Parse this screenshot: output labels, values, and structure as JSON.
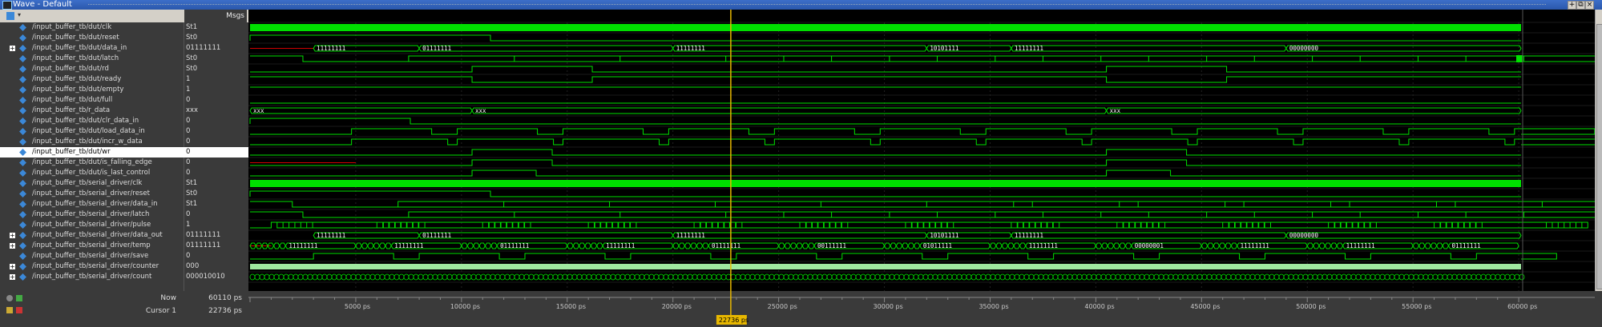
{
  "window": {
    "title": "Wave - Default"
  },
  "header": {
    "msgs_label": "Msgs"
  },
  "signals": [
    {
      "name": "/input_buffer_tb/dut/clk",
      "value": "St1",
      "expand": false
    },
    {
      "name": "/input_buffer_tb/dut/reset",
      "value": "St0",
      "expand": false
    },
    {
      "name": "/input_buffer_tb/dut/data_in",
      "value": "01111111",
      "expand": true
    },
    {
      "name": "/input_buffer_tb/dut/latch",
      "value": "St0",
      "expand": false
    },
    {
      "name": "/input_buffer_tb/dut/rd",
      "value": "St0",
      "expand": false
    },
    {
      "name": "/input_buffer_tb/dut/ready",
      "value": "1",
      "expand": false
    },
    {
      "name": "/input_buffer_tb/dut/empty",
      "value": "1",
      "expand": false
    },
    {
      "name": "/input_buffer_tb/dut/full",
      "value": "0",
      "expand": false
    },
    {
      "name": "/input_buffer_tb/r_data",
      "value": "xxx",
      "expand": false
    },
    {
      "name": "/input_buffer_tb/dut/clr_data_in",
      "value": "0",
      "expand": false
    },
    {
      "name": "/input_buffer_tb/dut/load_data_in",
      "value": "0",
      "expand": false
    },
    {
      "name": "/input_buffer_tb/dut/incr_w_data",
      "value": "0",
      "expand": false
    },
    {
      "name": "/input_buffer_tb/dut/wr",
      "value": "0",
      "expand": false,
      "selected": true
    },
    {
      "name": "/input_buffer_tb/dut/is_falling_edge",
      "value": "0",
      "expand": false
    },
    {
      "name": "/input_buffer_tb/dut/is_last_control",
      "value": "0",
      "expand": false
    },
    {
      "name": "/input_buffer_tb/serial_driver/clk",
      "value": "St1",
      "expand": false
    },
    {
      "name": "/input_buffer_tb/serial_driver/reset",
      "value": "St0",
      "expand": false
    },
    {
      "name": "/input_buffer_tb/serial_driver/data_in",
      "value": "St1",
      "expand": false
    },
    {
      "name": "/input_buffer_tb/serial_driver/latch",
      "value": "0",
      "expand": false
    },
    {
      "name": "/input_buffer_tb/serial_driver/pulse",
      "value": "1",
      "expand": false
    },
    {
      "name": "/input_buffer_tb/serial_driver/data_out",
      "value": "01111111",
      "expand": true
    },
    {
      "name": "/input_buffer_tb/serial_driver/temp",
      "value": "01111111",
      "expand": true
    },
    {
      "name": "/input_buffer_tb/serial_driver/save",
      "value": "0",
      "expand": false
    },
    {
      "name": "/input_buffer_tb/serial_driver/counter",
      "value": "000",
      "expand": true
    },
    {
      "name": "/input_buffer_tb/serial_driver/count",
      "value": "000010010",
      "expand": true
    }
  ],
  "bus_labels": {
    "data_in": [
      "11111111",
      "01111111",
      "11111111",
      "10101111",
      "11111111",
      "00000000"
    ],
    "r_data": [
      "xxx",
      "xxx",
      "xxx"
    ],
    "data_out": [
      "11111111",
      "01111111",
      "11111111",
      "10101111",
      "11111111",
      "00000000"
    ],
    "temp": [
      "11111111",
      "11111111",
      "01111111",
      "11111111",
      "01111111",
      "00111111",
      "01011111",
      "11111111",
      "00000001"
    ]
  },
  "footer": {
    "now_label": "Now",
    "now_value": "60110 ps",
    "cursor_label": "Cursor 1",
    "cursor_value": "22736 ps",
    "cursor_marker": "22736 ps"
  },
  "timeline": {
    "ticks": [
      "5000 ps",
      "10000 ps",
      "15000 ps",
      "20000 ps",
      "25000 ps",
      "30000 ps",
      "35000 ps",
      "40000 ps",
      "45000 ps",
      "50000 ps",
      "55000 ps",
      "60000 ps"
    ],
    "tick_values_ps": [
      5000,
      10000,
      15000,
      20000,
      25000,
      30000,
      35000,
      40000,
      45000,
      50000,
      55000,
      60000
    ],
    "cursor_ps": 22736,
    "range_ps": [
      0,
      60110
    ]
  },
  "colors": {
    "wave": "#00e000",
    "cursor": "#e8b800",
    "undefined": "#d00000"
  }
}
